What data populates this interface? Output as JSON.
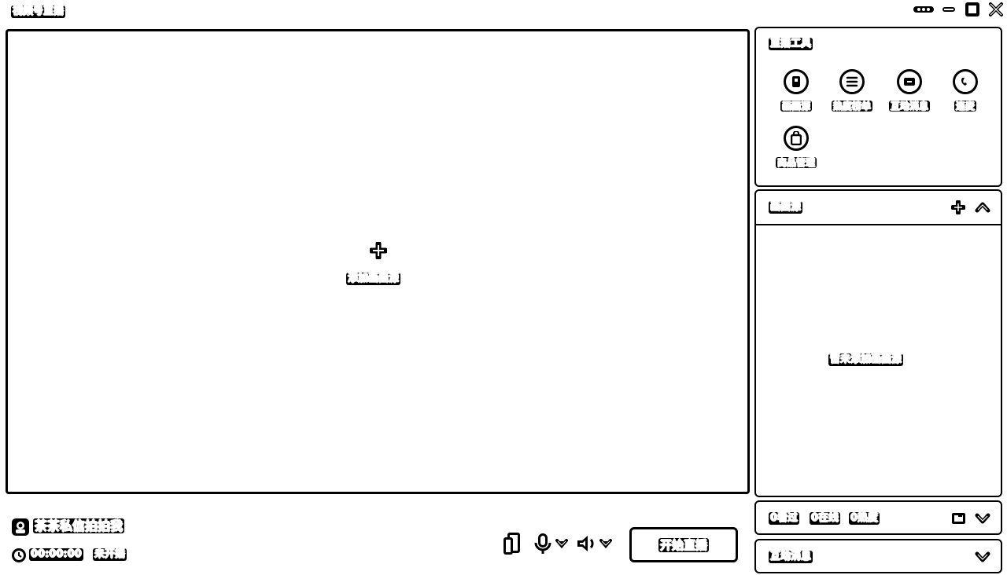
{
  "window": {
    "title": "视频号直播",
    "controls": [
      "more-icon",
      "minimize-icon",
      "maximize-icon",
      "close-icon"
    ]
  },
  "preview": {
    "add_source_label": "添加画面源"
  },
  "tools": {
    "title": "直播工具",
    "items": [
      {
        "label": "画面源",
        "icon": "screen-source-icon"
      },
      {
        "label": "热度榜单",
        "icon": "list-icon"
      },
      {
        "label": "互动消息",
        "icon": "message-icon"
      },
      {
        "label": "连麦",
        "icon": "connect-icon"
      },
      {
        "label": "商品管理",
        "icon": "shopping-bag-icon"
      }
    ]
  },
  "sources": {
    "title": "画面源",
    "empty_text": "暂未添加画面源"
  },
  "stats": {
    "watched": "0看过",
    "online": "0在线",
    "heat": "0热度"
  },
  "interaction": {
    "title": "互动消息"
  },
  "bottom": {
    "account_name": "茶茶私信拍拍我",
    "timer": "00:00:00",
    "status": "未开播",
    "start_button": "开始直播"
  }
}
